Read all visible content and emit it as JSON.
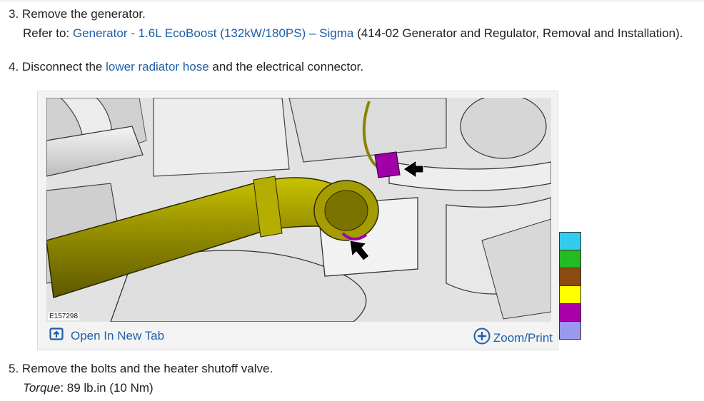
{
  "step3": {
    "number": "3.",
    "text": "Remove the generator.",
    "refer_prefix": "Refer to:",
    "link_text": "Generator - 1.6L EcoBoost (132kW/180PS) – Sigma",
    "refer_suffix": "(414-02 Generator and Regulator, Removal and Installation)."
  },
  "step4": {
    "number": "4.",
    "text_before": "Disconnect the",
    "link_text": "lower radiator hose",
    "text_after": "and the electrical connector."
  },
  "figure": {
    "id_label": "E157298",
    "open_tab_label": "Open In New Tab",
    "zoom_label": "Zoom/Print",
    "icons": [
      "open-new-tab-icon",
      "zoom-plus-icon",
      "arrow-pointer-icon"
    ]
  },
  "swatch_colors": [
    "#33ccee",
    "#22bb22",
    "#8a4a10",
    "#ffff00",
    "#aa00aa",
    "#9999ee"
  ],
  "step5": {
    "number": "5.",
    "text": "Remove the bolts and the heater shutoff valve.",
    "torque_label": "Torque",
    "torque_value": ": 89 lb.in (10 Nm)"
  }
}
